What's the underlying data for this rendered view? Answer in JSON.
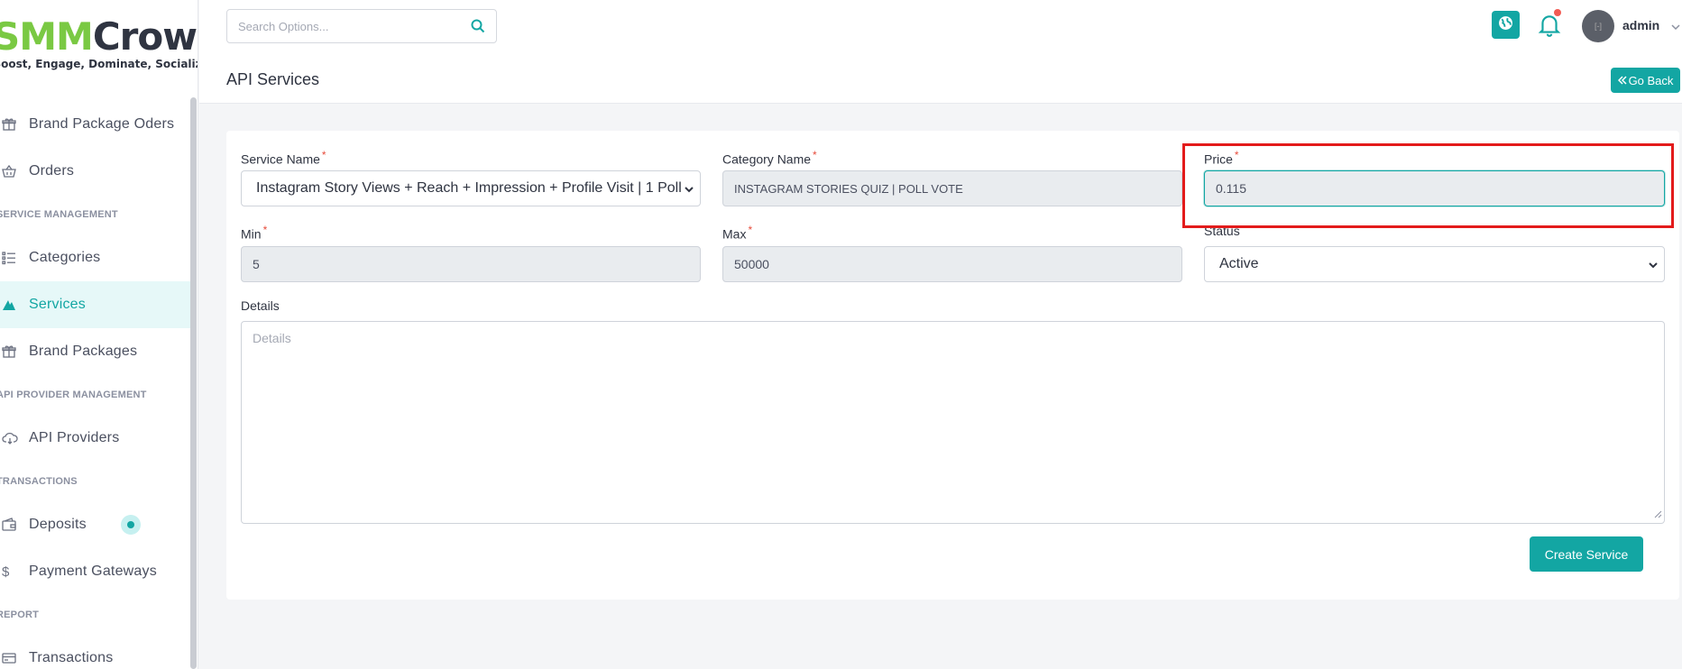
{
  "brand": {
    "name_part1": "SMM",
    "name_part2": "Crowd",
    "tagline": "Boost, Engage, Dominate, Socialize!"
  },
  "sidebar": {
    "items": [
      {
        "type": "item",
        "label": "Brand Package Oders",
        "icon": "gift-icon"
      },
      {
        "type": "item",
        "label": "Orders",
        "icon": "basket-icon"
      },
      {
        "type": "heading",
        "label": "SERVICE MANAGEMENT"
      },
      {
        "type": "item",
        "label": "Categories",
        "icon": "list-icon"
      },
      {
        "type": "item",
        "label": "Services",
        "icon": "chart-icon",
        "active": true
      },
      {
        "type": "item",
        "label": "Brand Packages",
        "icon": "gift-icon"
      },
      {
        "type": "heading",
        "label": "API PROVIDER MANAGEMENT"
      },
      {
        "type": "item",
        "label": "API Providers",
        "icon": "cloud-icon"
      },
      {
        "type": "heading",
        "label": "TRANSACTIONS"
      },
      {
        "type": "item",
        "label": "Deposits",
        "icon": "wallet-icon",
        "badge": true
      },
      {
        "type": "item",
        "label": "Payment Gateways",
        "icon": "dollar-icon"
      },
      {
        "type": "heading",
        "label": "REPORT"
      },
      {
        "type": "item",
        "label": "Transactions",
        "icon": "card-icon"
      }
    ]
  },
  "header": {
    "search_placeholder": "Search Options...",
    "page_title": "API Services",
    "user_name": "admin",
    "avatar_text": "[-]",
    "go_back_label": "Go Back"
  },
  "form": {
    "service_name": {
      "label": "Service Name",
      "value": "Instagram Story Views + Reach + Impression + Profile Visit | 1 Poll"
    },
    "category_name": {
      "label": "Category Name",
      "value": "INSTAGRAM STORIES QUIZ | POLL VOTE"
    },
    "price": {
      "label": "Price",
      "value": "0.115"
    },
    "min": {
      "label": "Min",
      "value": "5"
    },
    "max": {
      "label": "Max",
      "value": "50000"
    },
    "status": {
      "label": "Status",
      "value": "Active"
    },
    "details": {
      "label": "Details",
      "placeholder": "Details"
    },
    "submit_label": "Create Service"
  },
  "colors": {
    "accent": "#13a6a3",
    "highlight": "#e31b1b",
    "brand_green": "#7ac943"
  }
}
